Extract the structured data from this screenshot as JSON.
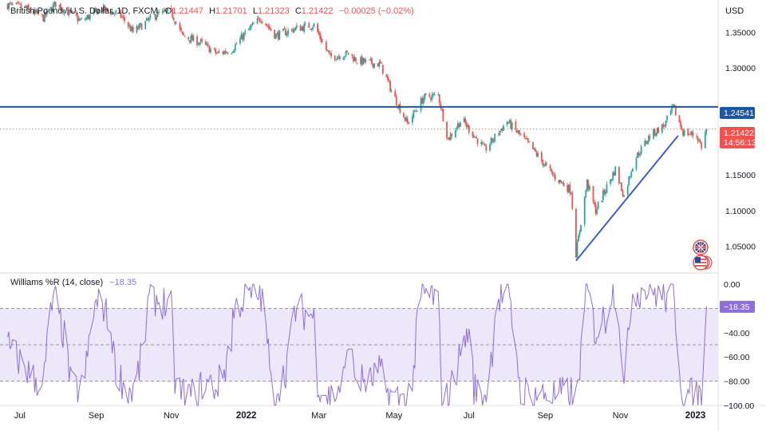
{
  "colors": {
    "up": "#26a69a",
    "down": "#ef5350",
    "level_line": "#1e56a0",
    "trendline": "#3a5fc8",
    "wr_line": "#8e6ed8",
    "wr_band": "#ede7fa",
    "last_price_bg": "#ef5350",
    "level_label_bg": "#1e56a0"
  },
  "header": {
    "symbol": "British Pound / U.S. Dollar, 1D, FXCM",
    "open_label": "O",
    "open": "1.21447",
    "high_label": "H",
    "high": "1.21701",
    "low_label": "L",
    "low": "1.21323",
    "close_label": "C",
    "close": "1.21422",
    "change": "−0.00025 (−0.02%)"
  },
  "currency": "USD",
  "price_axis_ticks": [
    "1.35000",
    "1.30000",
    "1.15000",
    "1.10000",
    "1.05000"
  ],
  "level_label": "1.24541",
  "last_price": {
    "value": "1.21422",
    "countdown": "14:56:13"
  },
  "flag_icons": [
    "gb-flag-icon",
    "us-flag-icon"
  ],
  "indicator": {
    "name": "Williams %R (14, close)",
    "value": "−18.35",
    "axis_ticks": [
      "0.00",
      "−40.00",
      "−60.00",
      "−80.00",
      "−100.00"
    ],
    "last_label": "−18.35"
  },
  "time_axis": [
    "Jul",
    "Sep",
    "Nov",
    "2022",
    "Mar",
    "May",
    "Jul",
    "Sep",
    "Nov",
    "2023"
  ],
  "chart_data": [
    {
      "type": "candlestick",
      "title": "British Pound / U.S. Dollar, 1D, FXCM",
      "ylim": [
        1.015,
        1.395
      ],
      "x_range": [
        "2021-06-20",
        "2023-01-13"
      ],
      "horizontal_level": 1.24541,
      "last_close": 1.21422,
      "trendline": {
        "from": [
          "2022-09-26",
          1.03
        ],
        "to": [
          "2022-12-18",
          1.205
        ]
      },
      "close_path": [
        [
          "2021-06-21",
          1.388
        ],
        [
          "2021-07-05",
          1.384
        ],
        [
          "2021-07-20",
          1.37
        ],
        [
          "2021-07-30",
          1.39
        ],
        [
          "2021-08-20",
          1.365
        ],
        [
          "2021-09-05",
          1.383
        ],
        [
          "2021-09-20",
          1.375
        ],
        [
          "2021-10-01",
          1.35
        ],
        [
          "2021-10-20",
          1.375
        ],
        [
          "2021-11-01",
          1.378
        ],
        [
          "2021-11-10",
          1.345
        ],
        [
          "2021-11-25",
          1.335
        ],
        [
          "2021-12-08",
          1.32
        ],
        [
          "2021-12-20",
          1.325
        ],
        [
          "2022-01-01",
          1.35
        ],
        [
          "2022-01-13",
          1.37
        ],
        [
          "2022-01-25",
          1.345
        ],
        [
          "2022-02-10",
          1.355
        ],
        [
          "2022-02-25",
          1.36
        ],
        [
          "2022-03-10",
          1.315
        ],
        [
          "2022-03-25",
          1.32
        ],
        [
          "2022-04-01",
          1.31
        ],
        [
          "2022-04-20",
          1.305
        ],
        [
          "2022-05-01",
          1.26
        ],
        [
          "2022-05-12",
          1.222
        ],
        [
          "2022-05-25",
          1.258
        ],
        [
          "2022-06-06",
          1.262
        ],
        [
          "2022-06-14",
          1.2
        ],
        [
          "2022-06-25",
          1.228
        ],
        [
          "2022-07-14",
          1.185
        ],
        [
          "2022-08-01",
          1.225
        ],
        [
          "2022-08-20",
          1.19
        ],
        [
          "2022-09-07",
          1.15
        ],
        [
          "2022-09-22",
          1.128
        ],
        [
          "2022-09-26",
          1.04
        ],
        [
          "2022-10-05",
          1.14
        ],
        [
          "2022-10-12",
          1.1
        ],
        [
          "2022-10-20",
          1.13
        ],
        [
          "2022-10-28",
          1.158
        ],
        [
          "2022-11-04",
          1.12
        ],
        [
          "2022-11-12",
          1.17
        ],
        [
          "2022-11-25",
          1.205
        ],
        [
          "2022-12-07",
          1.22
        ],
        [
          "2022-12-14",
          1.245
        ],
        [
          "2022-12-22",
          1.21
        ],
        [
          "2023-01-02",
          1.205
        ],
        [
          "2023-01-06",
          1.19
        ],
        [
          "2023-01-10",
          1.214
        ]
      ]
    },
    {
      "type": "line",
      "title": "Williams %R (14, close)",
      "ylim": [
        -100,
        0
      ],
      "bands": [
        -20,
        -50,
        -80
      ],
      "last_value": -18.35
    }
  ]
}
